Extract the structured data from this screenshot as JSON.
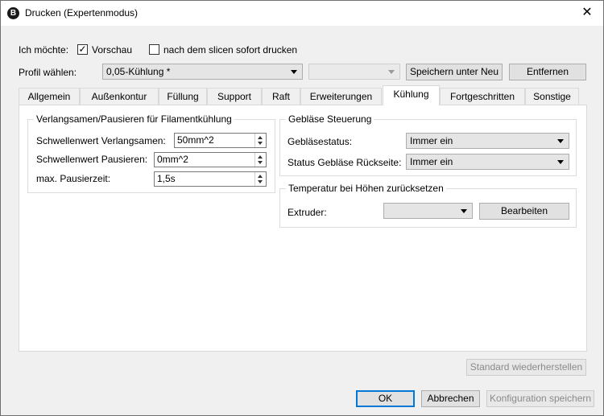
{
  "window": {
    "title": "Drucken (Expertenmodus)"
  },
  "top": {
    "want_label": "Ich möchte:",
    "preview_label": "Vorschau",
    "preview_checked": true,
    "slice_print_label": "nach dem slicen sofort drucken",
    "slice_print_checked": false,
    "profile_label": "Profil wählen:",
    "profile_value": "0,05-Kühlung *",
    "second_combo_value": "",
    "save_new_label": "Speichern unter Neu",
    "remove_label": "Entfernen"
  },
  "tabs": [
    "Allgemein",
    "Außenkontur",
    "Füllung",
    "Support",
    "Raft",
    "Erweiterungen",
    "Kühlung",
    "Fortgeschritten",
    "Sonstige"
  ],
  "active_tab": "Kühlung",
  "slowdown": {
    "title": "Verlangsamen/Pausieren für Filamentkühlung",
    "slow_label": "Schwellenwert Verlangsamen:",
    "slow_value": "50mm^2",
    "pause_label": "Schwellenwert Pausieren:",
    "pause_value": "0mm^2",
    "max_pause_label": "max. Pausierzeit:",
    "max_pause_value": "1,5s"
  },
  "fan": {
    "title": "Gebläse Steuerung",
    "status_label": "Gebläsestatus:",
    "status_value": "Immer ein",
    "back_label": "Status Gebläse Rückseite:",
    "back_value": "Immer ein"
  },
  "temp": {
    "title": "Temperatur bei Höhen zurücksetzen",
    "extruder_label": "Extruder:",
    "extruder_value": "",
    "edit_label": "Bearbeiten"
  },
  "footer": {
    "restore_label": "Standard wiederherstellen",
    "ok_label": "OK",
    "cancel_label": "Abbrechen",
    "save_config_label": "Konfiguration speichern"
  }
}
